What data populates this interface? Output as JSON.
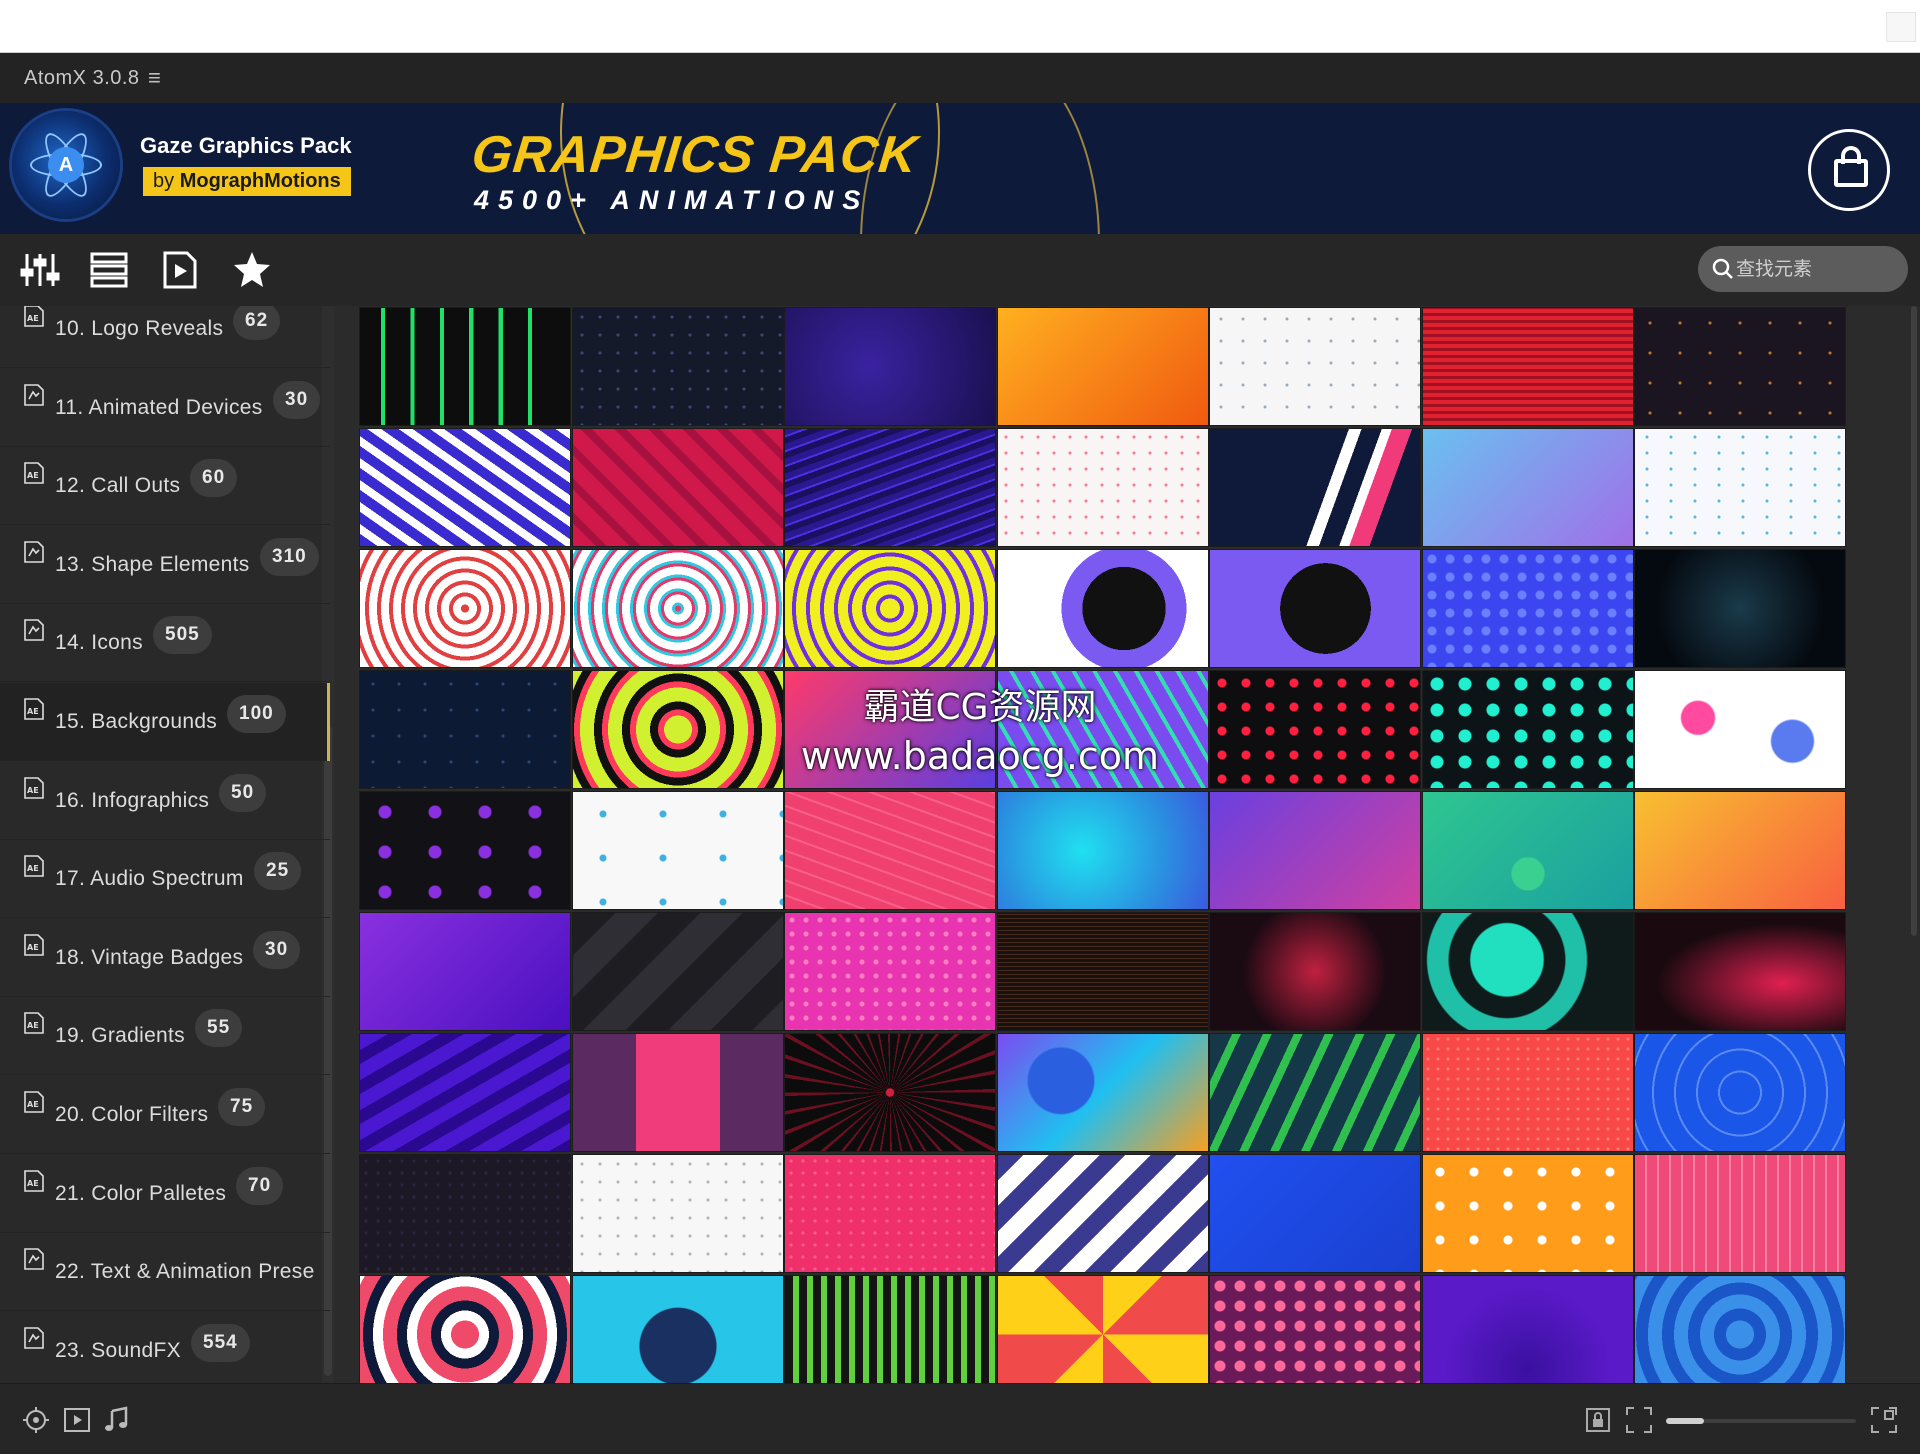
{
  "app": {
    "title": "AtomX 3.0.8",
    "menu_glyph": "≡"
  },
  "banner": {
    "pack_name": "Gaze Graphics Pack",
    "by_prefix": "by",
    "by_name": "MographMotions",
    "headline": "GRAPHICS PACK",
    "subline": "4500+ ANIMATIONS",
    "logo_letter": "A",
    "icon": "shopping-bag-icon",
    "accent": "#f5c518"
  },
  "toolbar": {
    "tools": [
      {
        "name": "filter-sliders-icon"
      },
      {
        "name": "list-view-icon"
      },
      {
        "name": "play-file-icon"
      },
      {
        "name": "star-icon"
      }
    ],
    "search_placeholder": "查找元素"
  },
  "sidebar": {
    "items": [
      {
        "label": "10. Logo Reveals",
        "count": "62",
        "icon": "ae-file-icon"
      },
      {
        "label": "11. Animated Devices",
        "count": "30",
        "icon": "preset-icon"
      },
      {
        "label": "12. Call Outs",
        "count": "60",
        "icon": "ae-file-icon"
      },
      {
        "label": "13. Shape Elements",
        "count": "310",
        "icon": "preset-icon"
      },
      {
        "label": "14. Icons",
        "count": "505",
        "icon": "preset-icon"
      },
      {
        "label": "15. Backgrounds",
        "count": "100",
        "icon": "ae-file-icon",
        "active": true
      },
      {
        "label": "16. Infographics",
        "count": "50",
        "icon": "ae-file-icon"
      },
      {
        "label": "17. Audio Spectrum",
        "count": "25",
        "icon": "ae-file-icon"
      },
      {
        "label": "18. Vintage Badges",
        "count": "30",
        "icon": "ae-file-icon"
      },
      {
        "label": "19. Gradients",
        "count": "55",
        "icon": "ae-file-icon"
      },
      {
        "label": "20. Color Filters",
        "count": "75",
        "icon": "ae-file-icon"
      },
      {
        "label": "21. Color Palletes",
        "count": "70",
        "icon": "ae-file-icon"
      },
      {
        "label": "22. Text & Animation Prese",
        "count": "",
        "icon": "preset-icon"
      },
      {
        "label": "23. SoundFX",
        "count": "554",
        "icon": "preset-icon"
      }
    ]
  },
  "watermark": {
    "line1": "霸道CG资源网",
    "line2": "www.badaocg.com"
  },
  "bottom": {
    "icons": [
      "target-icon",
      "play-icon",
      "music-note-icon"
    ],
    "right_icons": [
      "lock-icon",
      "fit-icon",
      "expand-icon"
    ],
    "zoom_fraction": 0.2
  },
  "tiles": [
    [
      "#0d0d0d",
      "#151a2a",
      "#22155a",
      "#f48a1f",
      "#f4f4f4",
      "#d0202a",
      "#1a1520"
    ],
    [
      "#3a2bd0",
      "#d0184a",
      "#2a1890",
      "#f7f2f2",
      "#0f1a3a",
      "#9aa4ee",
      "#f3f6fa"
    ],
    [
      "#f3eaea",
      "#f0f0f8",
      "#6b3bd4",
      "#ffffff",
      "#7b5bf0",
      "#3b45f0",
      "#0a1018"
    ],
    [
      "#0c1a33",
      "#ff3a5a",
      "#5a3ee0",
      "#7a4cf0",
      "#0e0e10",
      "#0c1418",
      "#ffffff"
    ],
    [
      "#121216",
      "#f8f8f8",
      "#f04070",
      "#27c6e8",
      "#8a40d8",
      "#2fc690",
      "#f8a83a"
    ],
    [
      "#6a1ee0",
      "#232327",
      "#e834b0",
      "#171212",
      "#1a0a12",
      "#0f1a1a",
      "#1a0a10"
    ],
    [
      "#4a18d0",
      "#f03c7a",
      "#0c0c0c",
      "#7a4cf0",
      "#153848",
      "#f84848",
      "#1a56e8"
    ],
    [
      "#1d1826",
      "#f7f7f7",
      "#f0306a",
      "#ffffff",
      "#2050f0",
      "#ff9c1a",
      "#f04a7a"
    ],
    [
      "#f04a6a",
      "#27c6e8",
      "#141414",
      "#ffd018",
      "#6a1a58",
      "#5a1ac8",
      "#3a90e8"
    ]
  ]
}
